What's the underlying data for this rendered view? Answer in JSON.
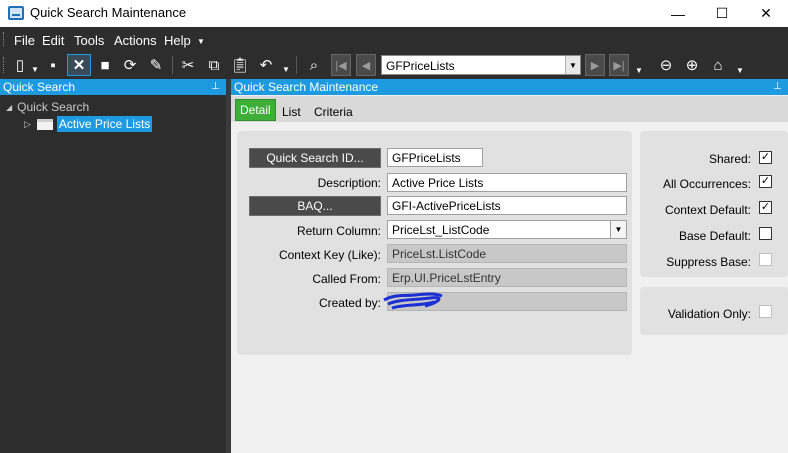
{
  "window": {
    "title": "Quick Search Maintenance",
    "minimize": "—",
    "maximize": "☐",
    "close": "✕"
  },
  "menu": [
    "File",
    "Edit",
    "Tools",
    "Actions",
    "Help"
  ],
  "toolbar": {
    "record_combo_value": "GFPriceLists",
    "icons": [
      "new-icon",
      "save-icon",
      "delete-icon",
      "stop-icon",
      "refresh-icon",
      "clear-icon",
      "cut-icon",
      "copy-icon",
      "paste-icon",
      "undo-icon",
      "search-icon",
      "first-icon",
      "previous-icon",
      "next-icon",
      "last-icon",
      "back-icon",
      "forward-icon",
      "home-icon"
    ]
  },
  "left_pane": {
    "header": "Quick Search",
    "tree_root": "Quick Search",
    "tree_child": "Active Price Lists"
  },
  "right_pane": {
    "header": "Quick Search Maintenance",
    "tabs": [
      "Detail",
      "List",
      "Criteria"
    ],
    "active_tab": "Detail"
  },
  "form": {
    "quick_search_id_button": "Quick Search ID...",
    "quick_search_id_value": "GFPriceLists",
    "description_label": "Description:",
    "description_value": "Active Price Lists",
    "baq_button": "BAQ...",
    "baq_value": "GFI-ActivePriceLists",
    "return_column_label": "Return Column:",
    "return_column_value": "PriceLst_ListCode",
    "context_key_label": "Context Key (Like):",
    "context_key_value": "PriceLst.ListCode",
    "called_from_label": "Called From:",
    "called_from_value": "Erp.UI.PriceLstEntry",
    "created_by_label": "Created by:",
    "created_by_value": ""
  },
  "options": {
    "shared_label": "Shared:",
    "shared": true,
    "all_occurrences_label": "All Occurrences:",
    "all_occurrences": true,
    "context_default_label": "Context Default:",
    "context_default": true,
    "base_default_label": "Base Default:",
    "base_default": false,
    "suppress_base_label": "Suppress Base:",
    "suppress_base": false,
    "validation_only_label": "Validation Only:",
    "validation_only": false
  },
  "colors": {
    "accent": "#1e9be0",
    "active_tab": "#3fae39",
    "toolbar_bg": "#2d2d2d"
  }
}
